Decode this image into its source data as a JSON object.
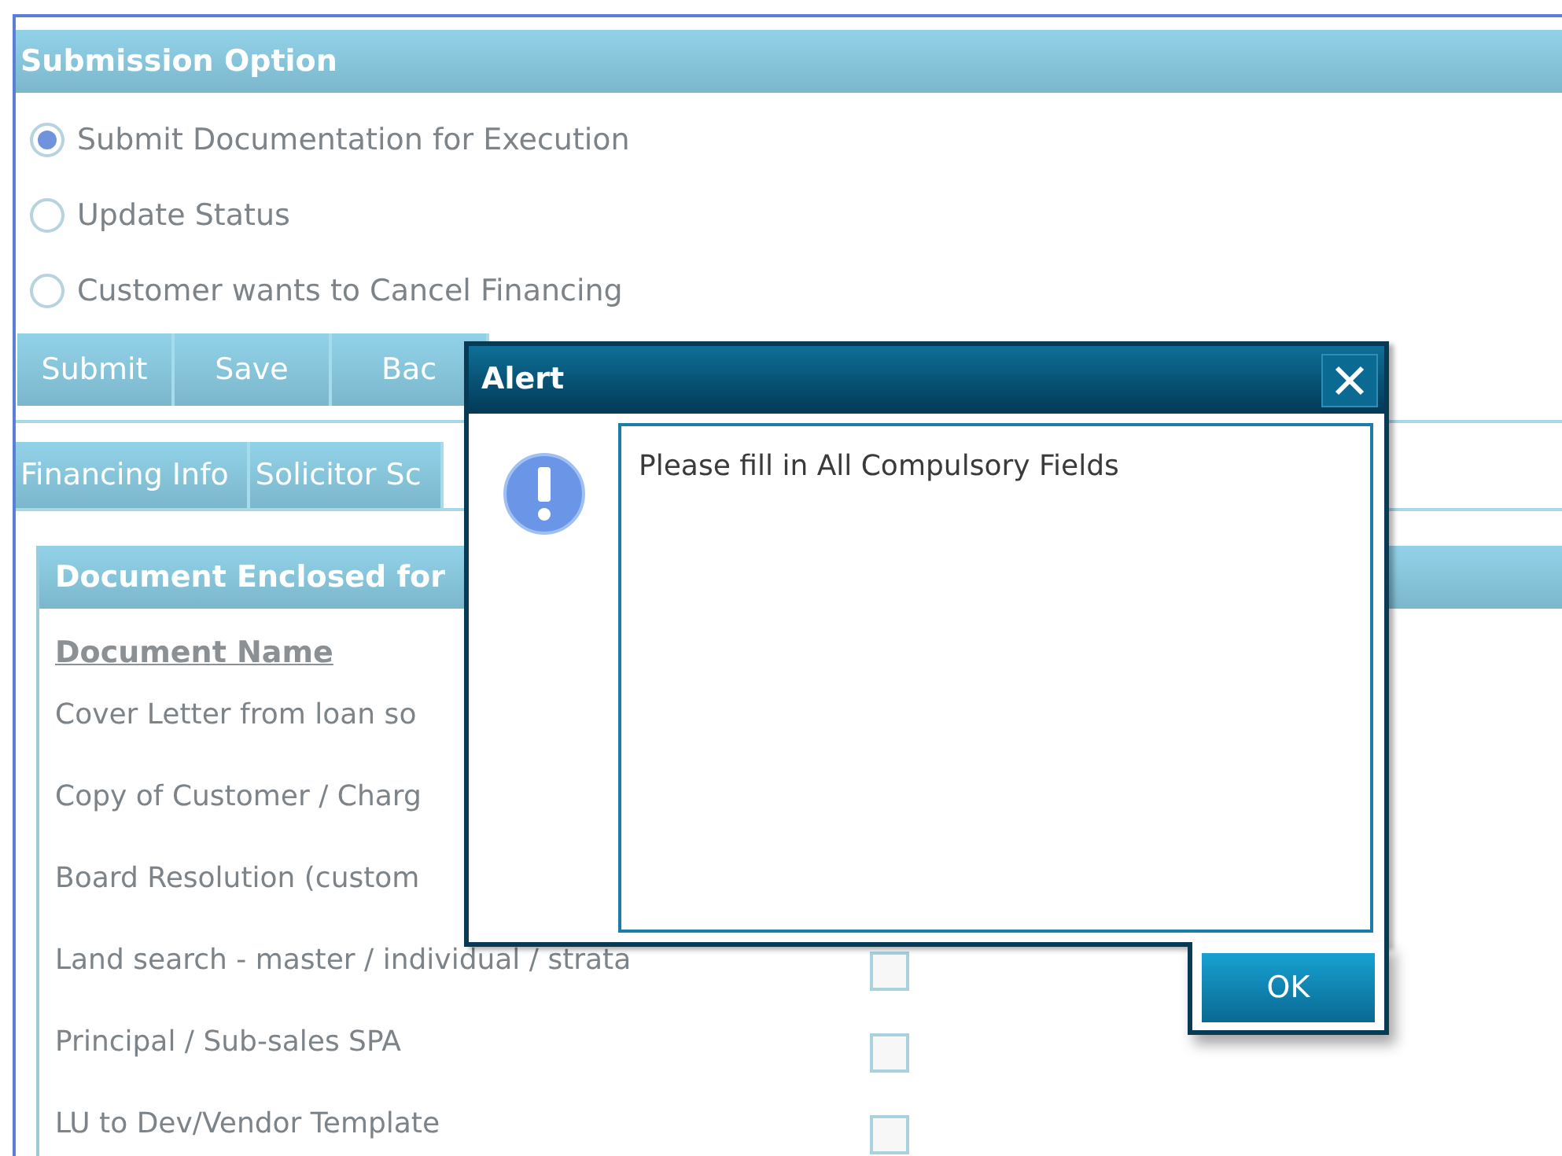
{
  "submission_option": {
    "title": "Submission Option",
    "options": [
      {
        "label": "Submit Documentation for Execution",
        "selected": true
      },
      {
        "label": "Update Status",
        "selected": false
      },
      {
        "label": "Customer wants to Cancel Financing",
        "selected": false
      }
    ],
    "buttons": [
      "Submit",
      "Save",
      "Bac"
    ]
  },
  "tabs": [
    "Financing Info",
    "Solicitor Sc"
  ],
  "documents": {
    "title": "Document Enclosed for",
    "column": "Document Name",
    "rows": [
      {
        "name": "Cover Letter from loan so"
      },
      {
        "name": "Copy of Customer / Charg"
      },
      {
        "name": "Board Resolution (custom"
      },
      {
        "name": "Land search - master / individual / strata",
        "checked": false
      },
      {
        "name": "Principal / Sub-sales SPA",
        "checked": false
      },
      {
        "name": "LU to Dev/Vendor Template",
        "checked": false
      }
    ]
  },
  "alert": {
    "title": "Alert",
    "message": "Please fill in All Compulsory Fields",
    "ok": "OK"
  }
}
